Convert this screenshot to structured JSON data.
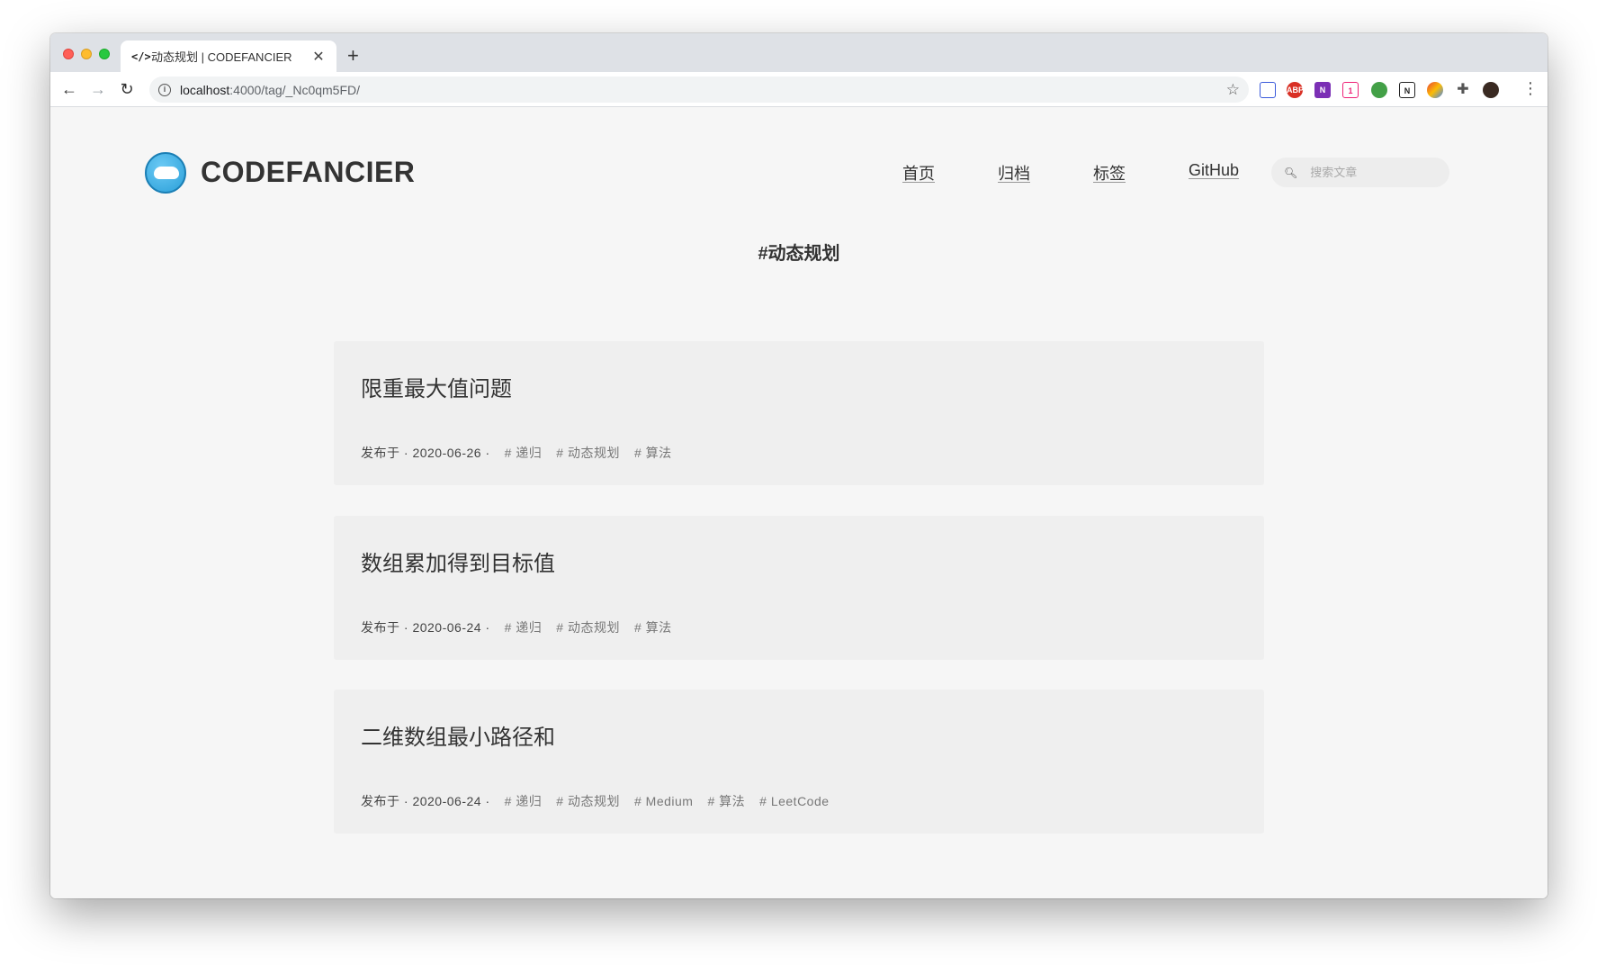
{
  "browser": {
    "tab_title": "动态规划 | CODEFANCIER",
    "tab_favicon": "</>",
    "new_tab": "+",
    "close": "✕",
    "url_host": "localhost",
    "url_path": ":4000/tag/_Nc0qm5FD/"
  },
  "site": {
    "title": "CODEFANCIER",
    "nav": [
      "首页",
      "归档",
      "标签",
      "GitHub"
    ],
    "search_placeholder": "搜索文章"
  },
  "tag_title": "#动态规划",
  "posts": [
    {
      "title": "限重最大值问题",
      "date_label": "发布于 · 2020-06-26 ·",
      "tags": [
        "# 递归",
        "# 动态规划",
        "# 算法"
      ]
    },
    {
      "title": "数组累加得到目标值",
      "date_label": "发布于 · 2020-06-24 ·",
      "tags": [
        "# 递归",
        "# 动态规划",
        "# 算法"
      ]
    },
    {
      "title": "二维数组最小路径和",
      "date_label": "发布于 · 2020-06-24 ·",
      "tags": [
        "# 递归",
        "# 动态规划",
        "# Medium",
        "# 算法",
        "# LeetCode"
      ]
    }
  ],
  "extensions": [
    "calendar-ext-icon",
    "adblock-ext-icon",
    "onenote-ext-icon",
    "cat-ext-icon",
    "green-dot-ext-icon",
    "notion-ext-icon",
    "color-ext-icon",
    "puzzle-ext-icon",
    "avatar-ext-icon"
  ]
}
